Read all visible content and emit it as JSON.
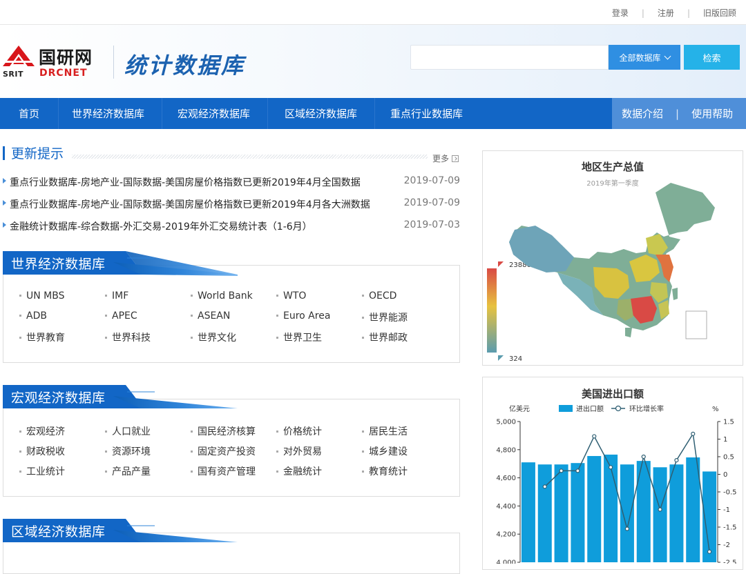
{
  "topbar": {
    "links": [
      "登录",
      "注册",
      "旧版回顾"
    ]
  },
  "header": {
    "logo_srit": "SRIT",
    "logo_cn": "国研网",
    "logo_en": "DRCNET",
    "site_title": "统计数据库",
    "search_placeholder": "",
    "search_select": "全部数据库",
    "search_button": "检索"
  },
  "nav": {
    "items": [
      "首页",
      "世界经济数据库",
      "宏观经济数据库",
      "区域经济数据库",
      "重点行业数据库"
    ],
    "right": [
      "数据介绍",
      "使用帮助"
    ]
  },
  "updates": {
    "title": "更新提示",
    "more": "更多",
    "items": [
      {
        "text": "重点行业数据库-房地产业-国际数据-美国房屋价格指数已更新2019年4月全国数据",
        "date": "2019-07-09"
      },
      {
        "text": "重点行业数据库-房地产业-国际数据-美国房屋价格指数已更新2019年4月各大洲数据",
        "date": "2019-07-09"
      },
      {
        "text": "金融统计数据库-综合数据-外汇交易-2019年外汇交易统计表（1-6月）",
        "date": "2019-07-03"
      }
    ]
  },
  "sections": [
    {
      "title": "世界经济数据库",
      "items": [
        "UN MBS",
        "IMF",
        "World Bank",
        "WTO",
        "OECD",
        "ADB",
        "APEC",
        "ASEAN",
        "Euro Area",
        "世界能源",
        "世界教育",
        "世界科技",
        "世界文化",
        "世界卫生",
        "世界邮政"
      ]
    },
    {
      "title": "宏观经济数据库",
      "items": [
        "宏观经济",
        "人口就业",
        "国民经济核算",
        "价格统计",
        "居民生活",
        "财政税收",
        "资源环境",
        "固定资产投资",
        "对外贸易",
        "城乡建设",
        "工业统计",
        "产品产量",
        "国有资产管理",
        "金融统计",
        "教育统计"
      ]
    },
    {
      "title": "区域经济数据库",
      "items": []
    }
  ],
  "map_panel": {
    "title": "地区生产总值",
    "subtitle": "2019年第一季度",
    "legend_max": "23886",
    "legend_min": "324"
  },
  "chart_data": {
    "type": "bar",
    "title": "美国进出口额",
    "ylabel": "亿美元",
    "y2label": "%",
    "ylim": [
      4000,
      5000
    ],
    "y2lim": [
      -2.5,
      1.5
    ],
    "yticks": [
      "5,000",
      "4,800",
      "4,600",
      "4,400",
      "4,200",
      "4,000"
    ],
    "y2ticks": [
      "1.5",
      "1",
      "0.5",
      "0",
      "-0.5",
      "-1",
      "-1.5",
      "-2",
      "-2.5"
    ],
    "series": [
      {
        "name": "进出口额",
        "type": "bar",
        "values": [
          4710,
          4695,
          4695,
          4705,
          4755,
          4765,
          4695,
          4720,
          4675,
          4695,
          4745,
          4645
        ]
      },
      {
        "name": "环比增长率",
        "type": "line",
        "values": [
          -0.35,
          0.1,
          0.1,
          1.08,
          0.2,
          -1.55,
          0.5,
          -1.0,
          0.4,
          1.15,
          -2.2
        ]
      }
    ],
    "legend": "top",
    "colors": {
      "bar": "#0f9ddb",
      "line": "#2f5f73"
    }
  }
}
